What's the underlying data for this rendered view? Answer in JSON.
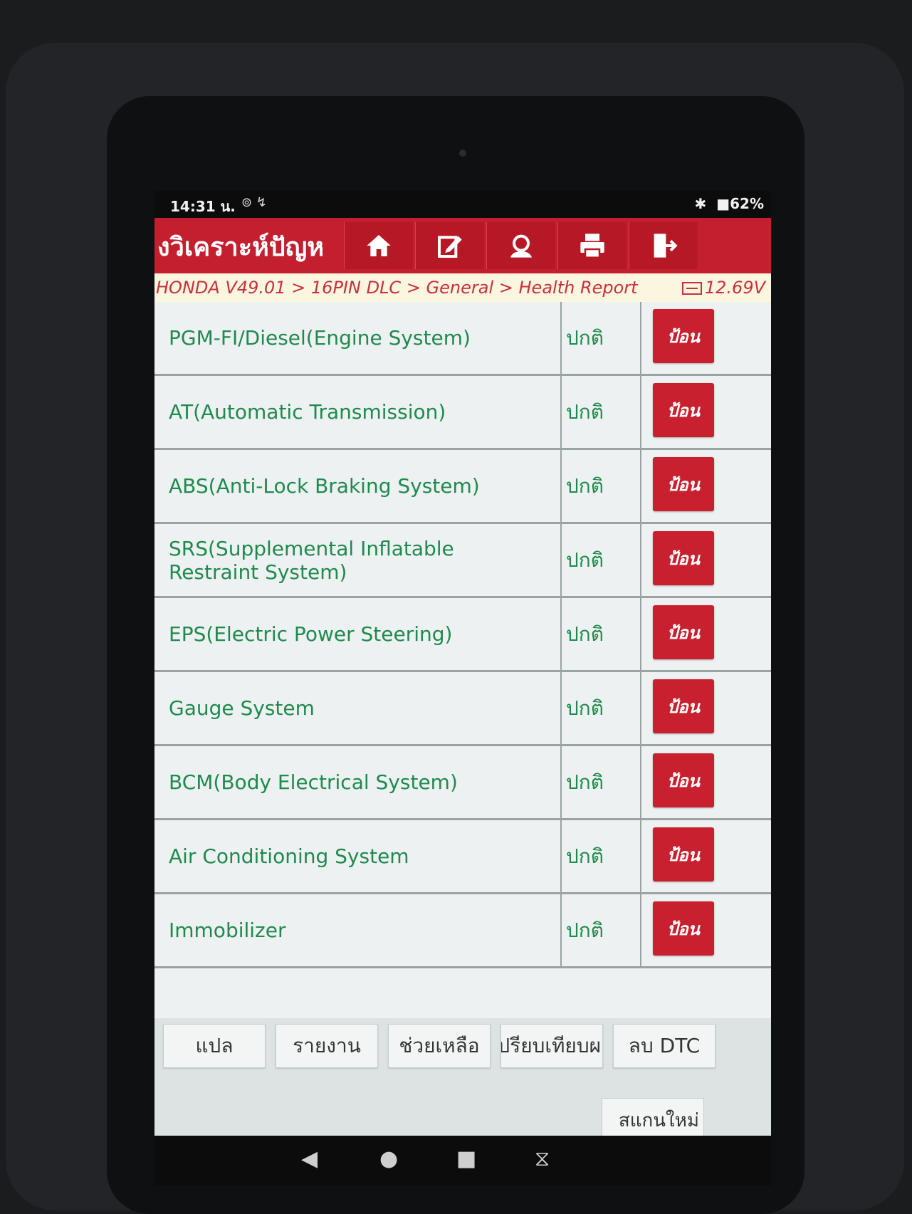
{
  "status_bar": {
    "time": "14:31 น.",
    "left_icons": "⊚ ↯",
    "bluetooth": "✱",
    "battery": "■62%"
  },
  "header": {
    "title": "งวิเคราะห์ปัญห",
    "toolbar": [
      {
        "icon": "home-icon"
      },
      {
        "icon": "edit-icon"
      },
      {
        "icon": "support-icon"
      },
      {
        "icon": "print-icon"
      },
      {
        "icon": "exit-icon"
      }
    ]
  },
  "breadcrumb": {
    "path": "HONDA V49.01 > 16PIN DLC > General > Health Report",
    "voltage": "12.69V"
  },
  "systems": [
    {
      "name": "PGM-FI/Diesel(Engine System)",
      "status": "ปกติ",
      "action": "ป้อน"
    },
    {
      "name": "AT(Automatic Transmission)",
      "status": "ปกติ",
      "action": "ป้อน"
    },
    {
      "name": "ABS(Anti-Lock Braking System)",
      "status": "ปกติ",
      "action": "ป้อน"
    },
    {
      "name": "SRS(Supplemental Inflatable Restraint System)",
      "status": "ปกติ",
      "action": "ป้อน"
    },
    {
      "name": "EPS(Electric Power Steering)",
      "status": "ปกติ",
      "action": "ป้อน"
    },
    {
      "name": "Gauge System",
      "status": "ปกติ",
      "action": "ป้อน"
    },
    {
      "name": "BCM(Body Electrical System)",
      "status": "ปกติ",
      "action": "ป้อน"
    },
    {
      "name": "Air Conditioning System",
      "status": "ปกติ",
      "action": "ป้อน"
    },
    {
      "name": "Immobilizer",
      "status": "ปกติ",
      "action": "ป้อน"
    }
  ],
  "bottom_buttons": {
    "translate": "แปล",
    "report": "รายงาน",
    "help": "ช่วยเหลือ",
    "compare": "เปรียบเทียบผล",
    "clear_dtc": "ลบ DTC",
    "rescan": "สแกนใหม่"
  },
  "android_nav": {
    "back": "◀",
    "home": "●",
    "recents": "■",
    "screenshot": "⧖"
  },
  "colors": {
    "accent_red": "#c41f2e",
    "text_green": "#1f8a4e",
    "breadcrumb_red": "#c8303c"
  }
}
